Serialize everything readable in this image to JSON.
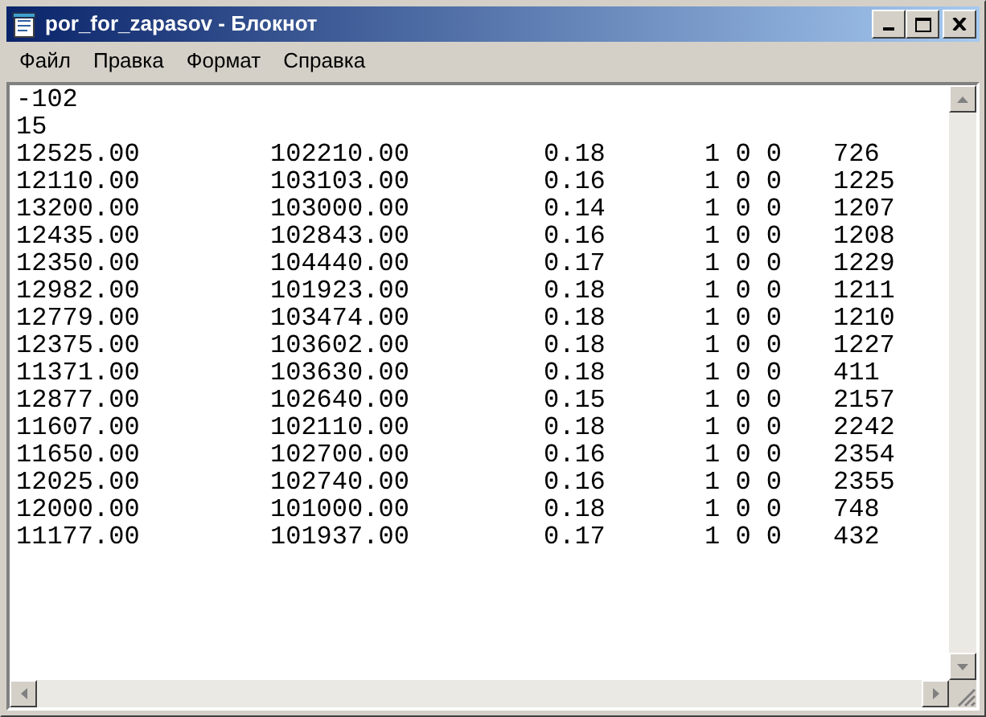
{
  "window": {
    "title": "por_for_zapasov - Блокнот",
    "active": true
  },
  "menu": [
    {
      "label": "Файл"
    },
    {
      "label": "Правка"
    },
    {
      "label": "Формат"
    },
    {
      "label": "Справка"
    }
  ],
  "document": {
    "lines": [
      {
        "cells": [
          "-102"
        ]
      },
      {
        "cells": [
          "15"
        ]
      },
      {
        "cells": [
          "12525.00",
          "102210.00",
          "0.18",
          "1 0 0",
          "726"
        ]
      },
      {
        "cells": [
          "12110.00",
          "103103.00",
          "0.16",
          "1 0 0",
          "1225"
        ]
      },
      {
        "cells": [
          "13200.00",
          "103000.00",
          "0.14",
          "1 0 0",
          "1207"
        ]
      },
      {
        "cells": [
          "12435.00",
          "102843.00",
          "0.16",
          "1 0 0",
          "1208"
        ]
      },
      {
        "cells": [
          "12350.00",
          "104440.00",
          "0.17",
          "1 0 0",
          "1229"
        ]
      },
      {
        "cells": [
          "12982.00",
          "101923.00",
          "0.18",
          "1 0 0",
          "1211"
        ]
      },
      {
        "cells": [
          "12779.00",
          "103474.00",
          "0.18",
          "1 0 0",
          "1210"
        ]
      },
      {
        "cells": [
          "12375.00",
          "103602.00",
          "0.18",
          "1 0 0",
          "1227"
        ]
      },
      {
        "cells": [
          "11371.00",
          "103630.00",
          "0.18",
          "1 0 0",
          "411"
        ]
      },
      {
        "cells": [
          "12877.00",
          "102640.00",
          "0.15",
          "1 0 0",
          "2157"
        ]
      },
      {
        "cells": [
          "11607.00",
          "102110.00",
          "0.18",
          "1 0 0",
          "2242"
        ]
      },
      {
        "cells": [
          "11650.00",
          "102700.00",
          "0.16",
          "1 0 0",
          "2354"
        ]
      },
      {
        "cells": [
          "12025.00",
          "102740.00",
          "0.16",
          "1 0 0",
          "2355"
        ]
      },
      {
        "cells": [
          "12000.00",
          "101000.00",
          "0.18",
          "1 0 0",
          "748"
        ]
      },
      {
        "cells": [
          "11177.00",
          "101937.00",
          "0.17",
          "1 0 0",
          "432"
        ]
      }
    ]
  }
}
